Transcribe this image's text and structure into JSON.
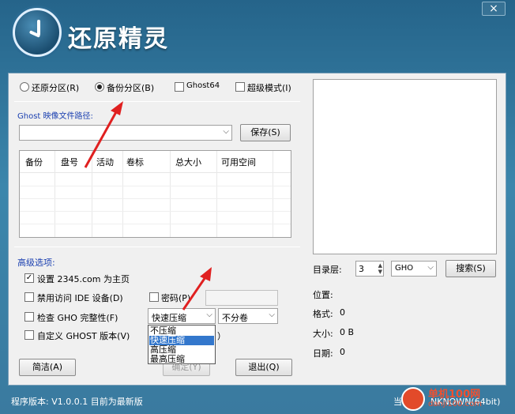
{
  "app": {
    "title": "还原精灵",
    "close_label": "×"
  },
  "mode": {
    "restore_label": "还原分区(R)",
    "backup_label": "备份分区(B)",
    "ghost64_label": "Ghost64",
    "super_label": "超级模式(I)",
    "selected": "backup"
  },
  "ghost_path": {
    "label": "Ghost 映像文件路径:",
    "value": "",
    "save_label": "保存(S)"
  },
  "table": {
    "columns": [
      "备份",
      "盘号",
      "活动",
      "卷标",
      "总大小",
      "可用空间"
    ]
  },
  "advanced": {
    "title": "高级选项:",
    "homepage_label": "设置 2345.com 为主页",
    "homepage_checked": true,
    "ide_label": "禁用访问 IDE 设备(D)",
    "password_label": "密码(P)",
    "check_label": "检查 GHO 完整性(F)",
    "custom_ghost_label": "自定义 GHOST 版本(V)",
    "compress_value": "快速压缩",
    "compress_options": [
      "不压缩",
      "快速压缩",
      "高压缩",
      "最高压缩"
    ],
    "compress_selected_index": 1,
    "split_value": "不分卷",
    "custom_ghost_value_partial": "）"
  },
  "buttons": {
    "clean": "简洁(A)",
    "ok": "确定(Y)",
    "exit": "退出(Q)"
  },
  "directory": {
    "level_label": "目录层:",
    "level_value": "3",
    "ext_value": "GHO",
    "search_label": "搜索(S)"
  },
  "info": {
    "position_label": "位置:",
    "format_label": "格式:",
    "format_value": "0",
    "size_label": "大小:",
    "size_value": "0 B",
    "date_label": "日期:",
    "date_value": "0"
  },
  "footer": {
    "version_text": "程序版本: V1.0.0.1  目前为最新版",
    "system_text": "当前系",
    "system_tail": "NKNOWN(64bit)"
  },
  "watermark": {
    "line1": "单机100网",
    "line2": "danji100.com"
  }
}
